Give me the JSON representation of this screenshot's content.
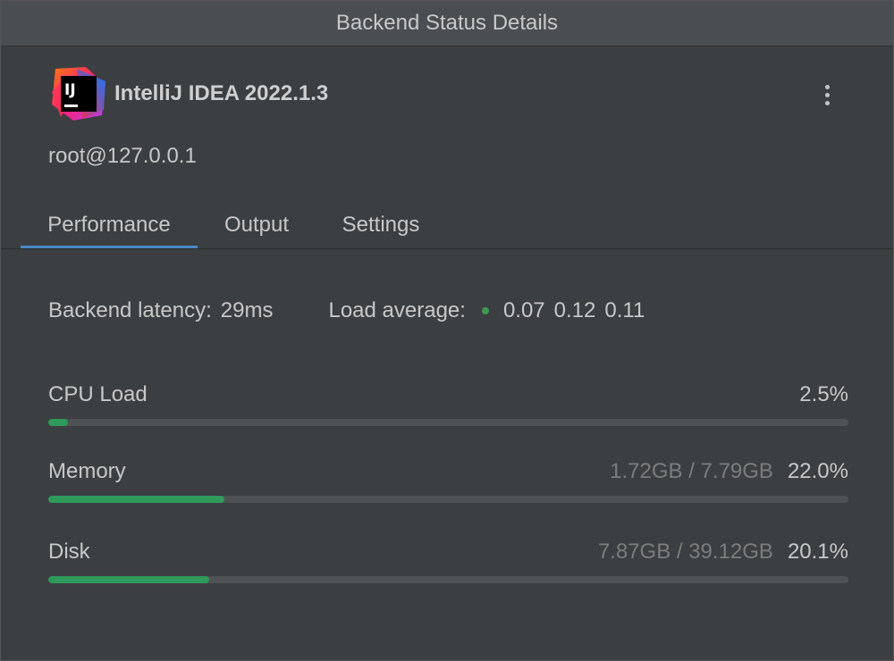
{
  "window": {
    "title": "Backend Status Details"
  },
  "header": {
    "logo_text": "IJ",
    "product_name": "IntelliJ IDEA 2022.1.3",
    "menu_icon": "more-vertical-icon"
  },
  "host": "root@127.0.0.1",
  "tabs": [
    {
      "label": "Performance",
      "active": true
    },
    {
      "label": "Output",
      "active": false
    },
    {
      "label": "Settings",
      "active": false
    }
  ],
  "stats": {
    "latency_label": "Backend latency:",
    "latency_value": "29ms",
    "load_label": "Load average:",
    "load_status_color": "#3d9a52",
    "load_1": "0.07",
    "load_5": "0.12",
    "load_15": "0.11"
  },
  "metrics": {
    "cpu": {
      "label": "CPU Load",
      "usage": "",
      "percent": "2.5%",
      "fraction": 0.025
    },
    "memory": {
      "label": "Memory",
      "usage": "1.72GB / 7.79GB",
      "percent": "22.0%",
      "fraction": 0.22
    },
    "disk": {
      "label": "Disk",
      "usage": "7.87GB / 39.12GB",
      "percent": "20.1%",
      "fraction": 0.201
    }
  },
  "colors": {
    "accent": "#4a88c7",
    "bar_fill": "#2f9a5b",
    "bar_track": "#4e5254",
    "background": "#3c3f41"
  }
}
